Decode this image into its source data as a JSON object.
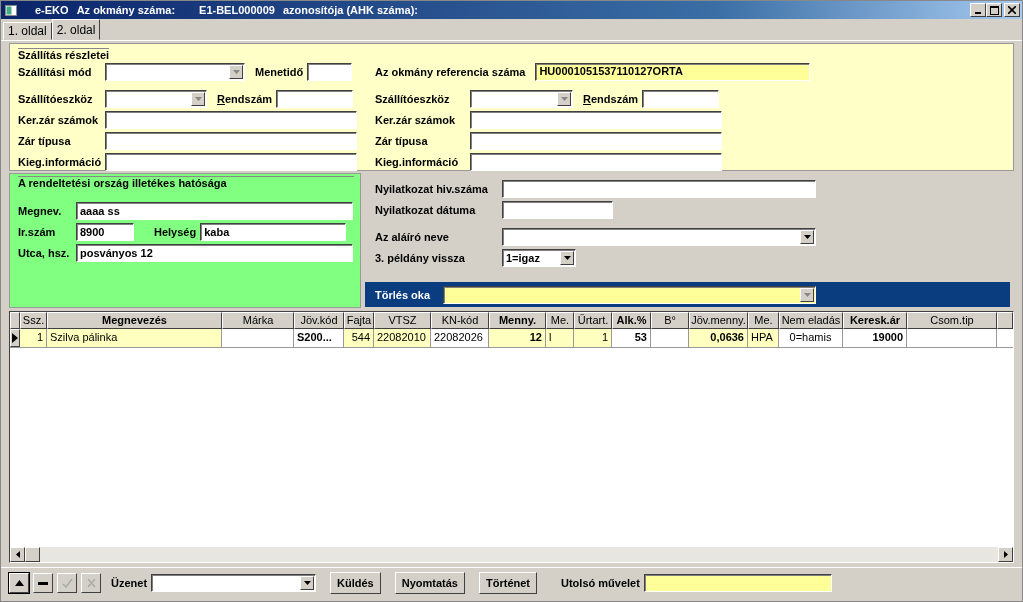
{
  "window": {
    "app": "e-EKO",
    "title_label": "Az okmány száma:",
    "document_number": "E1-BEL000009",
    "title_suffix": "azonosítója (AHK száma):"
  },
  "tabs": [
    {
      "label": "1. oldal",
      "selected": false
    },
    {
      "label": "2. oldal",
      "selected": true
    }
  ],
  "shipping": {
    "title": "Szállítás részletei",
    "left": [
      {
        "label": "Szállítási mód",
        "kind": "combo",
        "extra": {
          "label": "Menetidő",
          "kind": "text",
          "underline_first": false
        }
      },
      {
        "label": "Szállítóeszköz",
        "kind": "combo",
        "extra": {
          "label": "Rendszám",
          "kind": "text",
          "underline_first": true
        }
      },
      {
        "label": "Ker.zár számok",
        "kind": "text"
      },
      {
        "label": "Zár típusa",
        "kind": "text"
      },
      {
        "label": "Kieg.információ",
        "kind": "text"
      }
    ],
    "right": [
      {
        "label": "Az okmány referencia száma",
        "kind": "text",
        "value": "HU0001051537110127ORTA",
        "highlight": true
      },
      {
        "label": "Szállítóeszköz",
        "kind": "combo",
        "extra": {
          "label": "Rendszám",
          "kind": "text",
          "underline_first": true
        }
      },
      {
        "label": "Ker.zár számok",
        "kind": "text"
      },
      {
        "label": "Zár típusa",
        "kind": "text"
      },
      {
        "label": "Kieg.információ",
        "kind": "text"
      }
    ]
  },
  "authority": {
    "title": "A rendeltetési ország illetékes hatósága",
    "name": {
      "label": "Megnev.",
      "value": "aaaa ss"
    },
    "postcode": {
      "label": "Ir.szám",
      "value": "8900"
    },
    "city": {
      "label": "Helység",
      "value": "kaba"
    },
    "street": {
      "label": "Utca, hsz.",
      "value": "posványos 12"
    }
  },
  "declaration": [
    {
      "label": "Nyilatkozat hiv.száma",
      "kind": "text"
    },
    {
      "label": "Nyilatkozat dátuma",
      "kind": "text"
    },
    {
      "label": "Az aláíró neve",
      "kind": "combo"
    },
    {
      "label": "3. példány vissza",
      "kind": "combo",
      "value": "1=igaz"
    }
  ],
  "deletion": {
    "label": "Törlés oka"
  },
  "table": {
    "columns": [
      {
        "label": "Ssz.",
        "bold": false
      },
      {
        "label": "Megnevezés",
        "bold": true
      },
      {
        "label": "Márka",
        "bold": false
      },
      {
        "label": "Jöv.kód",
        "bold": false
      },
      {
        "label": "Fajta",
        "bold": false
      },
      {
        "label": "VTSZ",
        "bold": false
      },
      {
        "label": "KN-kód",
        "bold": false
      },
      {
        "label": "Menny.",
        "bold": true
      },
      {
        "label": "Me.",
        "bold": false
      },
      {
        "label": "Űrtart.",
        "bold": false
      },
      {
        "label": "Alk.%",
        "bold": true
      },
      {
        "label": "B°",
        "bold": false
      },
      {
        "label": "Jöv.menny.",
        "bold": false
      },
      {
        "label": "Me.",
        "bold": false
      },
      {
        "label": "Nem eladás",
        "bold": false
      },
      {
        "label": "Keresk.ár",
        "bold": true
      },
      {
        "label": "Csom.tip",
        "bold": false
      }
    ],
    "rows": [
      {
        "selected": true,
        "cells": [
          {
            "text": "1",
            "highlight": true,
            "bold": false
          },
          {
            "text": "Szilva pálinka",
            "highlight": true,
            "bold": false
          },
          {
            "highlight": false
          },
          {
            "text": "S200...",
            "highlight": false,
            "bold": true
          },
          {
            "text": "544",
            "highlight": true,
            "bold": false
          },
          {
            "text": "22082010",
            "highlight": true,
            "bold": false
          },
          {
            "text": "22082026",
            "highlight": false,
            "bold": false
          },
          {
            "text": "12",
            "highlight": true,
            "bold": true
          },
          {
            "text": "l",
            "highlight": true,
            "bold": false
          },
          {
            "text": "1",
            "highlight": true,
            "bold": false
          },
          {
            "text": "53",
            "highlight": false,
            "bold": true
          },
          {
            "highlight": false
          },
          {
            "text": "0,0636",
            "highlight": true,
            "bold": true
          },
          {
            "text": "HPA",
            "highlight": true,
            "bold": false
          },
          {
            "text": "0=hamis",
            "highlight": false,
            "bold": false
          },
          {
            "text": "19000",
            "highlight": false,
            "bold": true
          },
          {
            "highlight": false
          }
        ]
      }
    ]
  },
  "toolbar": {
    "nav_buttons": [
      {
        "kind": "up",
        "disabled": false
      },
      {
        "kind": "minus",
        "disabled": false
      },
      {
        "kind": "check",
        "disabled": true
      },
      {
        "kind": "cross",
        "disabled": true
      }
    ],
    "message_label": "Üzenet",
    "send": "Küldés",
    "print": "Nyomtatás",
    "history": "Történet",
    "last_action_label": "Utolsó művelet"
  }
}
